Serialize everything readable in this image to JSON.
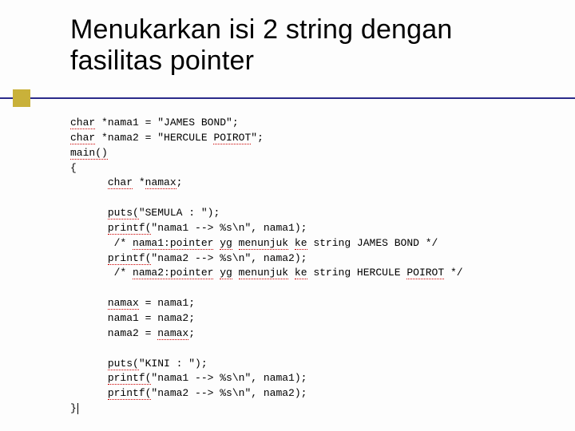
{
  "slide": {
    "title": "Menukarkan isi 2 string dengan fasilitas pointer"
  },
  "code": {
    "l01_a": "char",
    "l01_b": " *nama1 = \"JAMES BOND\";",
    "l02_a": "char",
    "l02_b": " *nama2 = \"HERCULE ",
    "l02_c": "POIROT",
    "l02_d": "\";",
    "l03_a": "main()",
    "l04": "{",
    "l05_a": "      ",
    "l05_b": "char",
    "l05_c": " *",
    "l05_d": "namax",
    "l05_e": ";",
    "blank1": "",
    "l06_a": "      ",
    "l06_b": "puts(",
    "l06_c": "\"SEMULA : \");",
    "l07_a": "      ",
    "l07_b": "printf(",
    "l07_c": "\"nama1 --> %s\\n\", nama1);",
    "l08_a": "       /* ",
    "l08_b": "nama1:pointer",
    "l08_c": " ",
    "l08_d": "yg",
    "l08_e": " ",
    "l08_f": "menunjuk",
    "l08_g": " ",
    "l08_h": "ke",
    "l08_i": " string JAMES BOND */",
    "l09_a": "      ",
    "l09_b": "printf(",
    "l09_c": "\"nama2 --> %s\\n\", nama2);",
    "l10_a": "       /* ",
    "l10_b": "nama2:pointer",
    "l10_c": " ",
    "l10_d": "yg",
    "l10_e": " ",
    "l10_f": "menunjuk",
    "l10_g": " ",
    "l10_h": "ke",
    "l10_i": " string HERCULE ",
    "l10_j": "POIROT",
    "l10_k": " */",
    "blank2": "",
    "l11_a": "      ",
    "l11_b": "namax",
    "l11_c": " = nama1;",
    "l12": "      nama1 = nama2;",
    "l13_a": "      nama2 = ",
    "l13_b": "namax",
    "l13_c": ";",
    "blank3": "",
    "l14_a": "      ",
    "l14_b": "puts(",
    "l14_c": "\"KINI : \");",
    "l15_a": "      ",
    "l15_b": "printf(",
    "l15_c": "\"nama1 --> %s\\n\", nama1);",
    "l16_a": "      ",
    "l16_b": "printf(",
    "l16_c": "\"nama2 --> %s\\n\", nama2);",
    "l17": "}"
  }
}
